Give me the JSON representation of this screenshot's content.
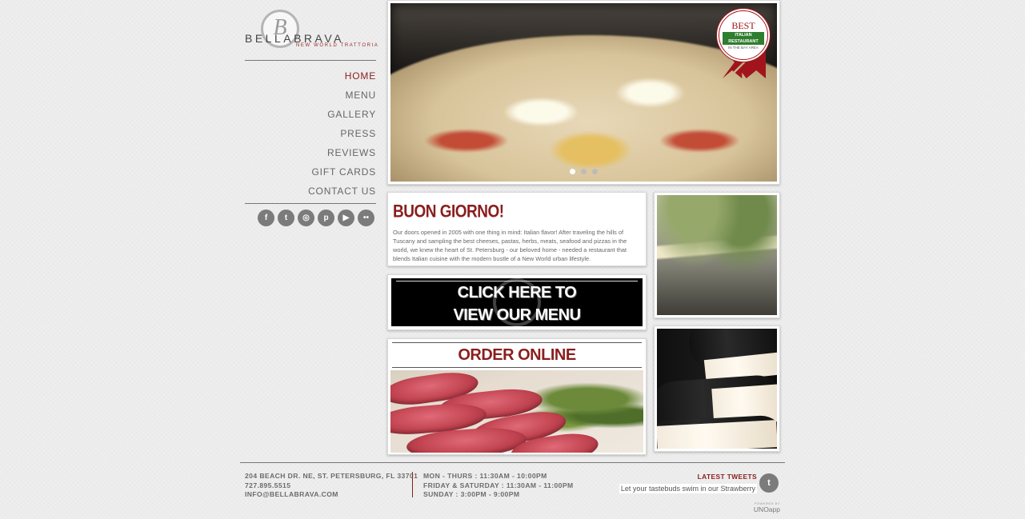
{
  "logo": {
    "monogram": "B",
    "name": "BELLABRAVA",
    "tagline": "NEW WORLD TRATTORIA"
  },
  "nav": {
    "items": [
      {
        "label": "HOME",
        "active": true
      },
      {
        "label": "MENU",
        "active": false
      },
      {
        "label": "GALLERY",
        "active": false
      },
      {
        "label": "PRESS",
        "active": false
      },
      {
        "label": "REVIEWS",
        "active": false
      },
      {
        "label": "GIFT CARDS",
        "active": false
      },
      {
        "label": "CONTACT US",
        "active": false
      }
    ]
  },
  "social": [
    {
      "icon": "facebook-icon",
      "glyph": "f"
    },
    {
      "icon": "twitter-icon",
      "glyph": "t"
    },
    {
      "icon": "instagram-icon",
      "glyph": "◎"
    },
    {
      "icon": "pinterest-icon",
      "glyph": "p"
    },
    {
      "icon": "youtube-icon",
      "glyph": "▶"
    },
    {
      "icon": "flickr-icon",
      "glyph": "••"
    }
  ],
  "hero": {
    "badge": {
      "top": "BEST",
      "middle": "ITALIAN RESTAURANT",
      "bottom": "IN THE BAY AREA"
    },
    "slides": 3,
    "active_slide": 0
  },
  "greeting": {
    "title": "BUON GIORNO!",
    "body": "Our doors opened in 2005 with one thing in mind: Italian flavor! After traveling the hills of Tuscany and sampling the best cheeses, pastas, herbs, meats, seafood and pizzas in the world, we knew the heart of St. Petersburg - our beloved home - needed a restaurant that blends Italian cuisine with the modern bustle of a New World urban lifestyle."
  },
  "menu_cta": {
    "line1": "CLICK HERE TO",
    "line2": "VIEW OUR MENU"
  },
  "order": {
    "title": "ORDER ONLINE"
  },
  "footer": {
    "address": [
      "204 BEACH DR. NE, ST. PETERSBURG, FL 33701",
      "727.895.5515",
      "INFO@BELLABRAVA.COM"
    ],
    "hours": [
      "MON - THURS : 11:30AM - 10:00PM",
      "FRIDAY & SATURDAY : 11:30AM - 11:00PM",
      "SUNDAY : 3:00PM - 9:00PM"
    ],
    "tweets_heading": "LATEST TWEETS",
    "tweet": "Let your tastebuds swim in our Strawberry",
    "powered_by": "POWERED BY",
    "powered_brand": "UNOapp"
  },
  "colors": {
    "accent": "#8b1e1e",
    "text": "#666666",
    "background": "#efefef",
    "icon_gray": "#7b7b7b"
  }
}
